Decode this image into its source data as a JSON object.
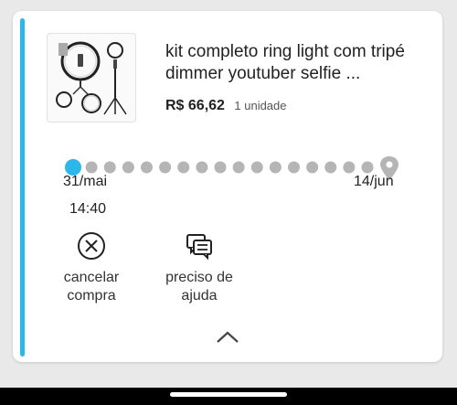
{
  "order": {
    "product_title": "kit completo ring light com tripé dimmer youtuber selfie ...",
    "price": "R$ 66,62",
    "quantity": "1 unidade",
    "image_icon": "ring-light-product-image"
  },
  "tracking": {
    "start_date": "31/mai",
    "end_date": "14/jun",
    "time": "14:40",
    "steps_total": 17,
    "steps_done": 1,
    "colors": {
      "active": "#2cb7ea",
      "pending": "#b5b5b5"
    }
  },
  "actions": {
    "cancel_label": "cancelar compra",
    "help_label": "preciso de ajuda"
  },
  "theme": {
    "accent": "#2cb7ea"
  }
}
